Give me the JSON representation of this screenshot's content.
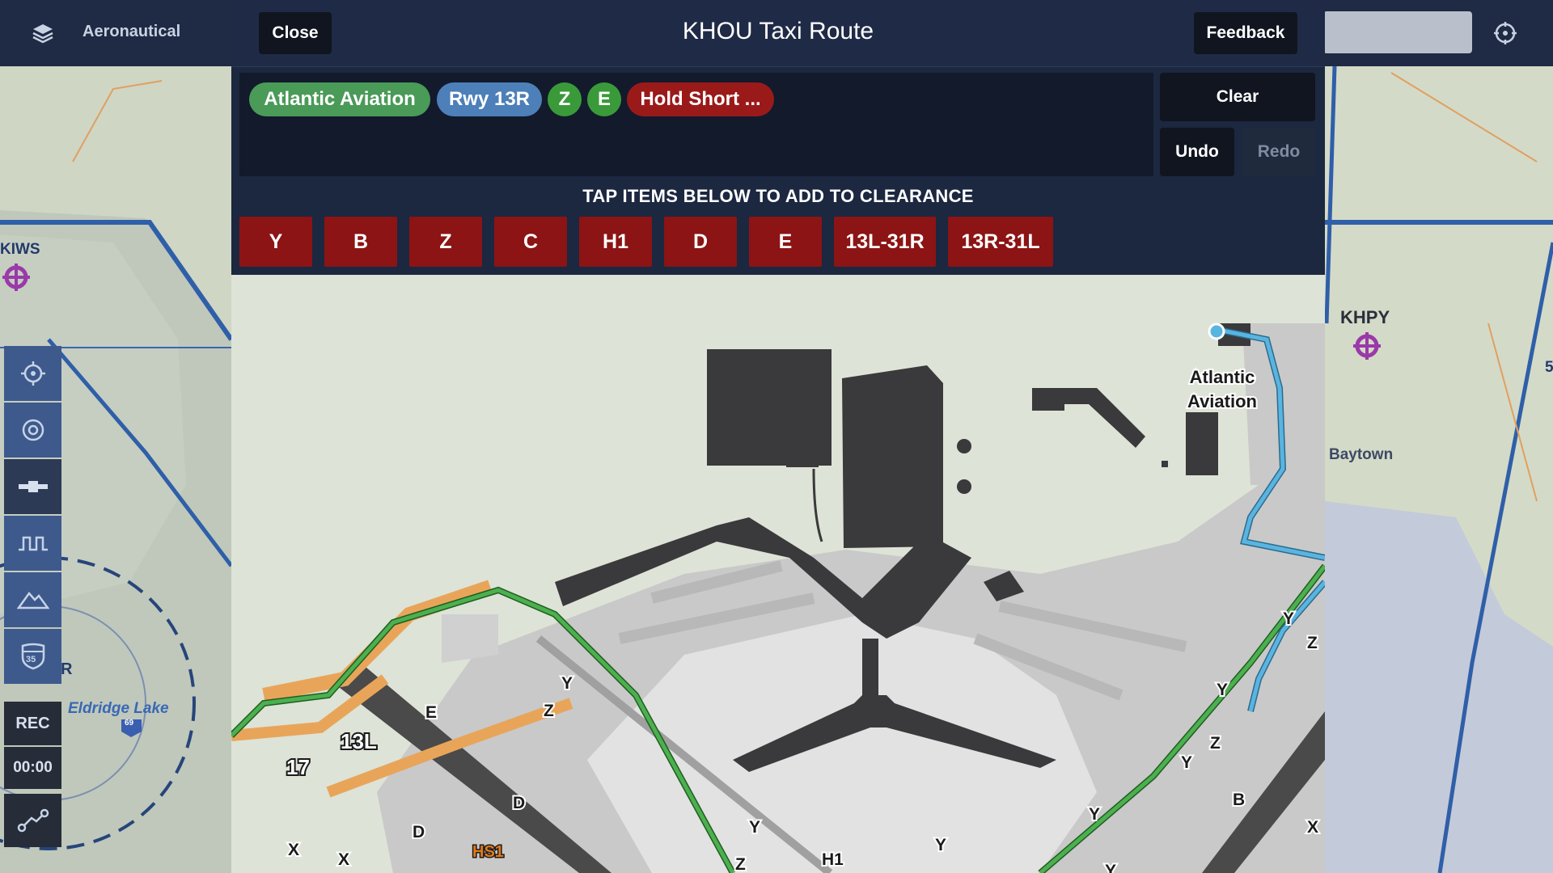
{
  "topbar": {
    "layers_label": "Aeronautical"
  },
  "base_map": {
    "labels": {
      "kiws": "KIWS",
      "khpy": "KHPY",
      "baytown": "Baytown",
      "eldridge": "Eldridge Lake",
      "r": "R",
      "five": "5",
      "shield": "69"
    }
  },
  "left_toolbar": {
    "rec_label": "REC",
    "timer": "00:00",
    "shield_number": "35"
  },
  "modal": {
    "title": "KHOU Taxi Route",
    "close_label": "Close",
    "feedback_label": "Feedback",
    "clear_label": "Clear",
    "undo_label": "Undo",
    "redo_label": "Redo",
    "instruction": "TAP ITEMS BELOW TO ADD TO CLEARANCE",
    "chips": [
      {
        "label": "Atlantic Aviation",
        "color": "#4a9a58"
      },
      {
        "label": "Rwy 13R",
        "color": "#4d7fb8"
      },
      {
        "label": "Z",
        "color": "#3a9a3a"
      },
      {
        "label": "E",
        "color": "#3a9a3a"
      },
      {
        "label": "Hold Short ...",
        "color": "#9a1a1a"
      }
    ],
    "options": [
      "Y",
      "B",
      "Z",
      "C",
      "H1",
      "D",
      "E",
      "13L-31R",
      "13R-31L"
    ]
  },
  "airport_map": {
    "fbo_label_line1": "Atlantic",
    "fbo_label_line2": "Aviation",
    "runway_labels": [
      "13L",
      "17"
    ],
    "taxiway_labels": [
      "Y",
      "Z",
      "E",
      "D",
      "D",
      "X",
      "X",
      "Y",
      "Y",
      "H1",
      "Z",
      "Y",
      "Y",
      "Y",
      "Z",
      "B",
      "Y",
      "Z",
      "X",
      "Y"
    ],
    "hotspot_label": "HS1",
    "route_color": "#4caf50",
    "fbo_route_color": "#5ab4e0"
  }
}
